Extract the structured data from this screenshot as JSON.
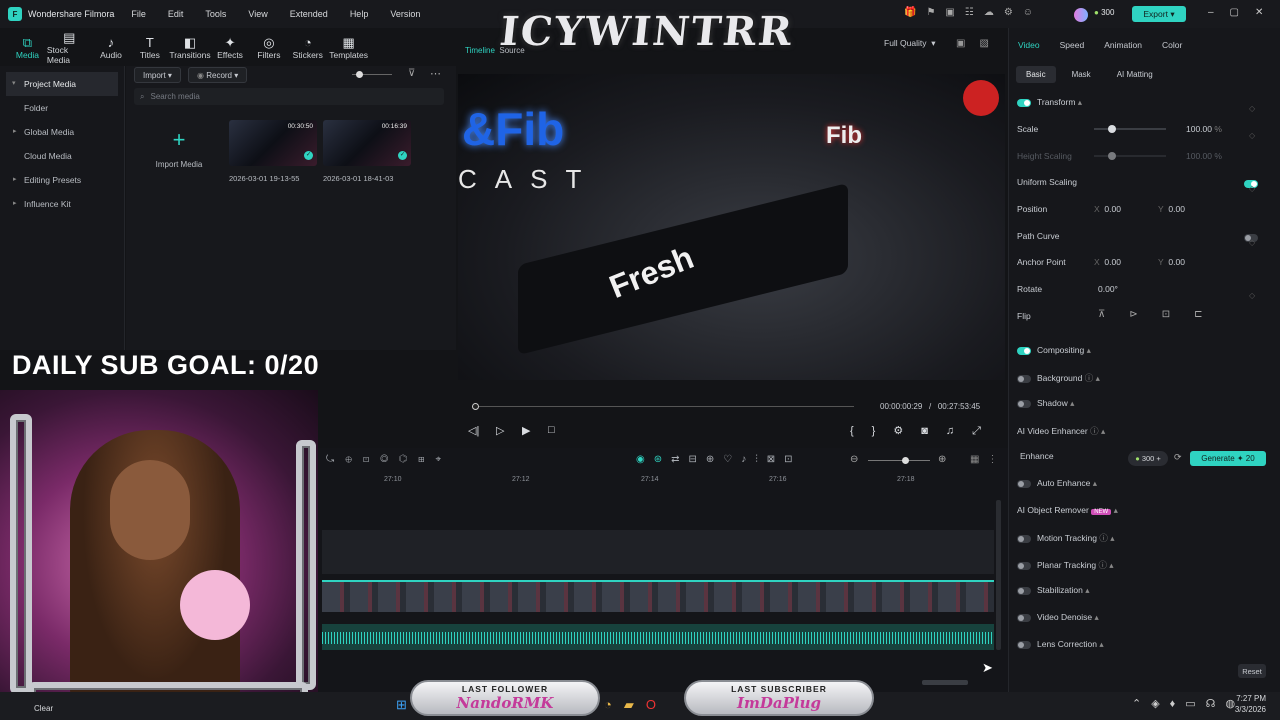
{
  "app": {
    "name": "Wondershare Filmora",
    "credits": "300",
    "export_label": "Export"
  },
  "menu": [
    "File",
    "Edit",
    "Tools",
    "View",
    "Extended",
    "Help",
    "Version"
  ],
  "tools": [
    "Media",
    "Stock Media",
    "Audio",
    "Titles",
    "Transitions",
    "Effects",
    "Filters",
    "Stickers",
    "Templates"
  ],
  "sidebar": [
    "Project Media",
    "Folder",
    "Global Media",
    "Cloud Media",
    "Editing Presets",
    "Influence Kit"
  ],
  "media": {
    "import_label": "Import",
    "record_label": "Record",
    "search_placeholder": "Search media",
    "import_media_label": "Import Media",
    "clips": [
      {
        "name": "2026-03-01 19-13-55",
        "duration": "00:30:50"
      },
      {
        "name": "2026-03-01 18-41-03",
        "duration": "00:16:39"
      }
    ]
  },
  "player": {
    "tabs": [
      "Timeline",
      "Source"
    ],
    "quality": "Full Quality",
    "current_time": "00:00:00:29",
    "separator": "/",
    "total_time": "00:27:53:45"
  },
  "timeline": {
    "ticks": [
      "27:10",
      "27:12",
      "27:14",
      "27:16",
      "27:18"
    ]
  },
  "properties": {
    "tabs": [
      "Video",
      "Speed",
      "Animation",
      "Color"
    ],
    "subtabs": [
      "Basic",
      "Mask",
      "AI Matting"
    ],
    "transform": "Transform",
    "scale_label": "Scale",
    "scale_value": "100.00",
    "height_scaling": "Height Scaling",
    "height_value": "100.00",
    "uniform_scaling": "Uniform Scaling",
    "position_label": "Position",
    "pos_x": "0.00",
    "pos_y": "0.00",
    "path_curve": "Path Curve",
    "anchor_label": "Anchor Point",
    "anchor_x": "0.00",
    "anchor_y": "0.00",
    "rotate_label": "Rotate",
    "rotate_value": "0.00°",
    "flip_label": "Flip",
    "compositing": "Compositing",
    "background": "Background",
    "shadow": "Shadow",
    "ai_video_enhancer": "AI Video Enhancer",
    "enhance": "Enhance",
    "enhance_credits": "300",
    "generate_label": "Generate",
    "generate_cost": "20",
    "auto_enhance": "Auto Enhance",
    "ai_object_remover": "AI Object Remover",
    "new_badge": "NEW",
    "motion_tracking": "Motion Tracking",
    "planar_tracking": "Planar Tracking",
    "stabilization": "Stabilization",
    "video_denoise": "Video Denoise",
    "lens_correction": "Lens Correction",
    "reset_label": "Reset"
  },
  "overlay": {
    "banner": "ICYWINTRR",
    "sub_goal": "DAILY SUB GOAL: 0/20",
    "last_follower_title": "LAST FOLLOWER",
    "last_follower": "NandoRMK",
    "last_subscriber_title": "LAST SUBSCRIBER",
    "last_subscriber": "ImDaPlug"
  },
  "taskbar": {
    "time": "7:27 PM",
    "date": "3/3/2026",
    "cleanup": "Clear"
  },
  "colors": {
    "accent": "#2fd3c1",
    "pink": "#c43a9a"
  }
}
